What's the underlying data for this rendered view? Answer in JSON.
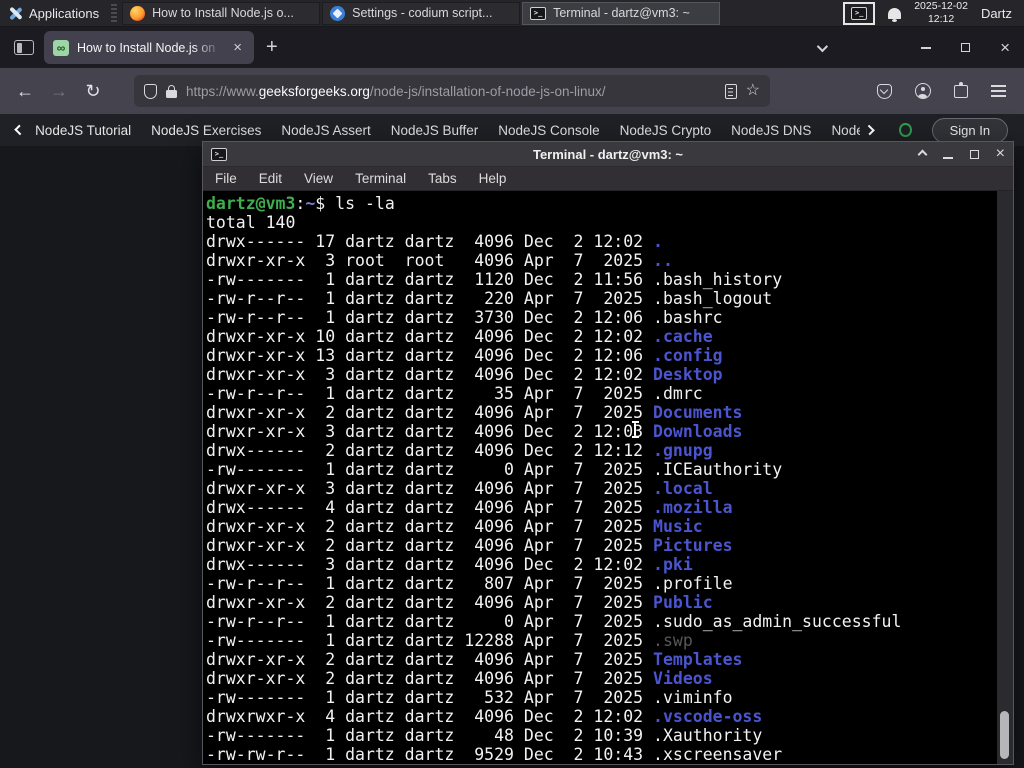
{
  "panel": {
    "applications_label": "Applications",
    "windows": [
      {
        "title": "How to Install Node.js o...",
        "icon": "ffx",
        "cls": ""
      },
      {
        "title": "Settings - codium script...",
        "icon": "codium",
        "cls": ""
      },
      {
        "title": "Terminal - dartz@vm3: ~",
        "icon": "termico",
        "cls": "active"
      }
    ],
    "clock_date": "2025-12-02",
    "clock_time": "12:12",
    "user": "Dartz"
  },
  "browser": {
    "tab_title": "How to Install Node.js on",
    "tab_close": "×",
    "new_tab": "+",
    "url_dim_prefix": "https://www.",
    "url_domain": "geeksforgeeks.org",
    "url_path": "/node-js/installation-of-node-js-on-linux/",
    "bookmark_star": "☆",
    "window_close": "×"
  },
  "site_nav": {
    "items": [
      "NodeJS Tutorial",
      "NodeJS Exercises",
      "NodeJS Assert",
      "NodeJS Buffer",
      "NodeJS Console",
      "NodeJS Crypto",
      "NodeJS DNS"
    ],
    "truncated_item": "Node",
    "sign_in": "Sign In"
  },
  "terminal": {
    "title": "Terminal - dartz@vm3: ~",
    "menu": [
      "File",
      "Edit",
      "View",
      "Terminal",
      "Tabs",
      "Help"
    ],
    "window_close": "×",
    "prompt": {
      "user_host": "dartz@vm3",
      "colon": ":",
      "path": "~",
      "command": "$ ls -la"
    },
    "rows": [
      {
        "pre": "total 140",
        "name": "",
        "type": "file"
      },
      {
        "pre": "drwx------ 17 dartz dartz  4096 Dec  2 12:02 ",
        "name": ".",
        "type": "dir"
      },
      {
        "pre": "drwxr-xr-x  3 root  root   4096 Apr  7  2025 ",
        "name": "..",
        "type": "dir"
      },
      {
        "pre": "-rw-------  1 dartz dartz  1120 Dec  2 11:56 ",
        "name": ".bash_history",
        "type": "file"
      },
      {
        "pre": "-rw-r--r--  1 dartz dartz   220 Apr  7  2025 ",
        "name": ".bash_logout",
        "type": "file"
      },
      {
        "pre": "-rw-r--r--  1 dartz dartz  3730 Dec  2 12:06 ",
        "name": ".bashrc",
        "type": "file"
      },
      {
        "pre": "drwxr-xr-x 10 dartz dartz  4096 Dec  2 12:02 ",
        "name": ".cache",
        "type": "dir"
      },
      {
        "pre": "drwxr-xr-x 13 dartz dartz  4096 Dec  2 12:06 ",
        "name": ".config",
        "type": "dir"
      },
      {
        "pre": "drwxr-xr-x  3 dartz dartz  4096 Dec  2 12:02 ",
        "name": "Desktop",
        "type": "dir"
      },
      {
        "pre": "-rw-r--r--  1 dartz dartz    35 Apr  7  2025 ",
        "name": ".dmrc",
        "type": "file"
      },
      {
        "pre": "drwxr-xr-x  2 dartz dartz  4096 Apr  7  2025 ",
        "name": "Documents",
        "type": "dir"
      },
      {
        "pre": "drwxr-xr-x  3 dartz dartz  4096 Dec  2 12:03 ",
        "name": "Downloads",
        "type": "dir"
      },
      {
        "pre": "drwx------  2 dartz dartz  4096 Dec  2 12:12 ",
        "name": ".gnupg",
        "type": "dir"
      },
      {
        "pre": "-rw-------  1 dartz dartz     0 Apr  7  2025 ",
        "name": ".ICEauthority",
        "type": "file"
      },
      {
        "pre": "drwxr-xr-x  3 dartz dartz  4096 Apr  7  2025 ",
        "name": ".local",
        "type": "dir"
      },
      {
        "pre": "drwx------  4 dartz dartz  4096 Apr  7  2025 ",
        "name": ".mozilla",
        "type": "dir"
      },
      {
        "pre": "drwxr-xr-x  2 dartz dartz  4096 Apr  7  2025 ",
        "name": "Music",
        "type": "dir"
      },
      {
        "pre": "drwxr-xr-x  2 dartz dartz  4096 Apr  7  2025 ",
        "name": "Pictures",
        "type": "dir"
      },
      {
        "pre": "drwx------  3 dartz dartz  4096 Dec  2 12:02 ",
        "name": ".pki",
        "type": "dir"
      },
      {
        "pre": "-rw-r--r--  1 dartz dartz   807 Apr  7  2025 ",
        "name": ".profile",
        "type": "file"
      },
      {
        "pre": "drwxr-xr-x  2 dartz dartz  4096 Apr  7  2025 ",
        "name": "Public",
        "type": "dir"
      },
      {
        "pre": "-rw-r--r--  1 dartz dartz     0 Apr  7  2025 ",
        "name": ".sudo_as_admin_successful",
        "type": "file"
      },
      {
        "pre": "-rw-------  1 dartz dartz 12288 Apr  7  2025 ",
        "name": ".swp",
        "type": "dim"
      },
      {
        "pre": "drwxr-xr-x  2 dartz dartz  4096 Apr  7  2025 ",
        "name": "Templates",
        "type": "dir"
      },
      {
        "pre": "drwxr-xr-x  2 dartz dartz  4096 Apr  7  2025 ",
        "name": "Videos",
        "type": "dir"
      },
      {
        "pre": "-rw-------  1 dartz dartz   532 Apr  7  2025 ",
        "name": ".viminfo",
        "type": "file"
      },
      {
        "pre": "drwxrwxr-x  4 dartz dartz  4096 Dec  2 12:02 ",
        "name": ".vscode-oss",
        "type": "dir"
      },
      {
        "pre": "-rw-------  1 dartz dartz    48 Dec  2 10:39 ",
        "name": ".Xauthority",
        "type": "file"
      },
      {
        "pre": "-rw-rw-r--  1 dartz dartz  9529 Dec  2 10:43 ",
        "name": ".xscreensaver",
        "type": "file"
      }
    ],
    "colors": {
      "prompt_green": "#3fae4e",
      "directory_blue": "#4a55cf",
      "dim_gray": "#56575b",
      "background": "#000000"
    }
  }
}
